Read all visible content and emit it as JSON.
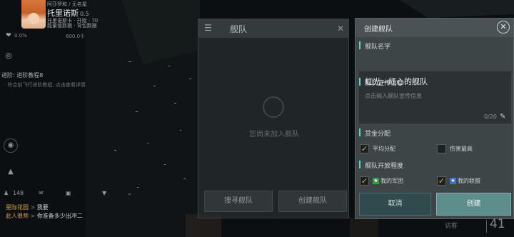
{
  "hud": {
    "top_line": "阿莎罗和 / 无名星",
    "player_name": "托里诺斯",
    "player_level": "0.5",
    "line2": "托里诺斯卡 · 开始 · 70",
    "line3": "能量值数据 · 背包数据",
    "res_left": "0.0%",
    "res_right": "600.0千",
    "mission_title": "进阶: 进阶教程8",
    "mission_desc": "· 符合前飞行进阶教程, 点击查看详情",
    "bottom_count": "148"
  },
  "chat": [
    {
      "channel": "星际花园",
      "text": "我要"
    },
    {
      "channel": "此人很帅",
      "text": "你准备多少出冲二"
    }
  ],
  "fleet_panel": {
    "title": "舰队",
    "empty_text": "您尚未加入舰队",
    "search_button": "搜寻舰队",
    "create_button": "创建舰队"
  },
  "dialog": {
    "title": "创建舰队",
    "name_label": "舰队名字",
    "name_value": "虹光—红心的舰队",
    "slogan_label": "舰队宣传信息",
    "slogan_placeholder": "点击输入舰队宣传信息",
    "slogan_counter": "0/20",
    "bounty_label": "赏金分配",
    "bounty_options": [
      {
        "label": "平均分配",
        "checked": true
      },
      {
        "label": "伤害最高",
        "checked": false
      }
    ],
    "open_label": "舰队开放程度",
    "open_options": [
      {
        "label": "我的军团",
        "checked": true,
        "icon": "green-star-icon"
      },
      {
        "label": "我的联盟",
        "checked": true,
        "icon": "blue-star-icon"
      }
    ],
    "cancel_button": "取消",
    "create_button": "创建"
  },
  "footer": {
    "tag": "访客",
    "number": "41"
  },
  "colors": {
    "accent_teal": "#5dd3c0",
    "check_orange": "#e6a93a",
    "create_button": "#5e8e8b",
    "cancel_button": "#2f4b4d",
    "chat_channel": "#d8a24c"
  }
}
